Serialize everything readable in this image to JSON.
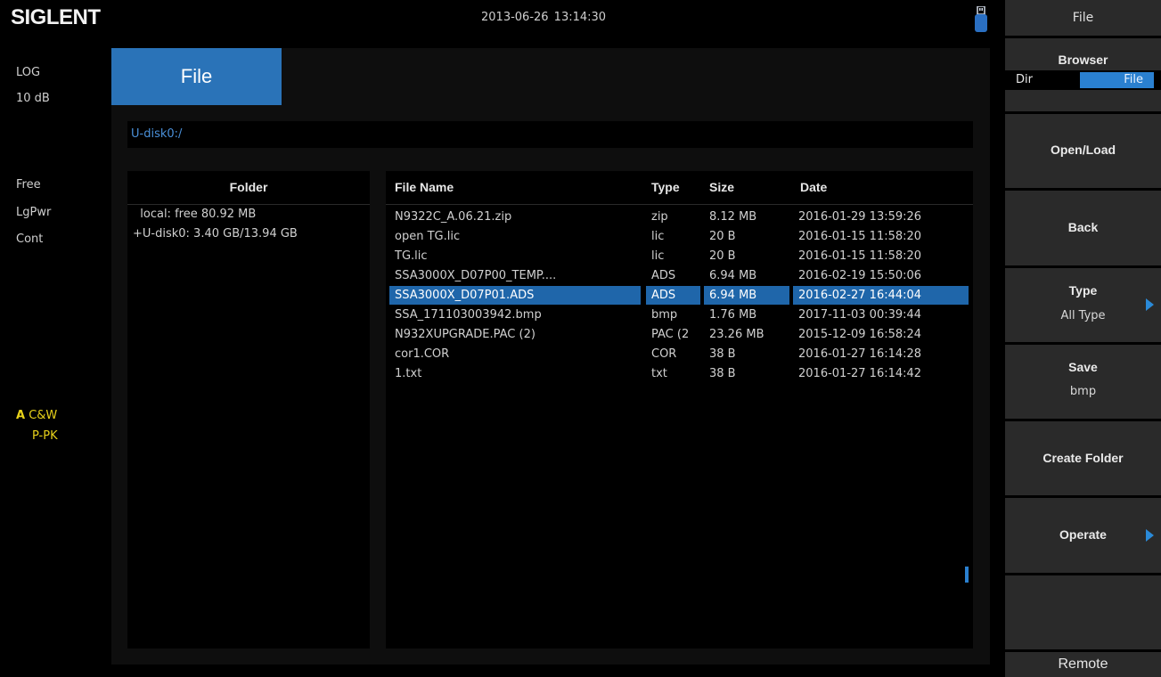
{
  "header": {
    "brand": "SIGLENT",
    "datetime": "2013-06-26   13:14:30"
  },
  "left_status": {
    "scale_type": "LOG",
    "scale_div": "10 dB",
    "sweep_mode": "Free",
    "detector": "LgPwr",
    "trigger": "Cont",
    "trace_letter": "A",
    "trace_mode": "C&W",
    "trace_detector": "P-PK"
  },
  "main": {
    "tab_title": "File",
    "path": "U-disk0:/",
    "folder_header": "Folder",
    "folders": [
      "  local: free 80.92 MB",
      "+U-disk0: 3.40 GB/13.94 GB"
    ],
    "columns": {
      "name": "File Name",
      "type": "Type",
      "size": "Size",
      "date": "Date"
    },
    "files": [
      {
        "name": "N9322C_A.06.21.zip",
        "type": "zip",
        "size": "8.12 MB",
        "date": "2016-01-29 13:59:26"
      },
      {
        "name": "open TG.lic",
        "type": "lic",
        "size": "20 B",
        "date": "2016-01-15 11:58:20"
      },
      {
        "name": "TG.lic",
        "type": "lic",
        "size": "20 B",
        "date": "2016-01-15 11:58:20"
      },
      {
        "name": "SSA3000X_D07P00_TEMP....",
        "type": "ADS",
        "size": "6.94 MB",
        "date": "2016-02-19 15:50:06"
      },
      {
        "name": "SSA3000X_D07P01.ADS",
        "type": "ADS",
        "size": "6.94 MB",
        "date": "2016-02-27 16:44:04"
      },
      {
        "name": "SSA_171103003942.bmp",
        "type": "bmp",
        "size": "1.76 MB",
        "date": "2017-11-03 00:39:44"
      },
      {
        "name": "N932XUPGRADE.PAC (2)",
        "type": "PAC (2",
        "size": "23.26 MB",
        "date": "2015-12-09 16:58:24"
      },
      {
        "name": "cor1.COR",
        "type": "COR",
        "size": "38 B",
        "date": "2016-01-27 16:14:28"
      },
      {
        "name": "1.txt",
        "type": "txt",
        "size": "38 B",
        "date": "2016-01-27 16:14:42"
      }
    ],
    "selected_index": 4
  },
  "softkeys": {
    "menu_title": "File",
    "browser": {
      "label": "Browser",
      "opt_dir": "Dir",
      "opt_file": "File",
      "selected": "File"
    },
    "open_load": "Open/Load",
    "back": "Back",
    "type": {
      "label": "Type",
      "value": "All Type"
    },
    "save": {
      "label": "Save",
      "value": "bmp"
    },
    "create_folder": "Create Folder",
    "operate": "Operate",
    "remote": "Remote"
  },
  "colors": {
    "accent": "#2a73b8",
    "selection": "#1f66aa",
    "trace_yellow": "#e8d21a",
    "softkey_bg": "#2a2a2a"
  }
}
